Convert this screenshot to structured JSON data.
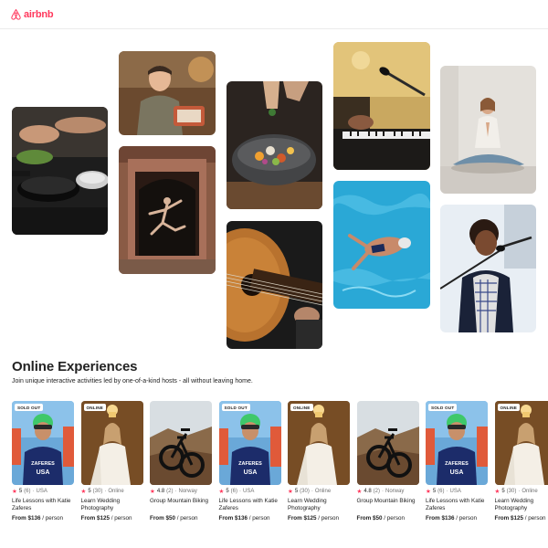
{
  "brand": {
    "name": "airbnb",
    "color": "#ff385c",
    "icon": "airbnb-logo-icon"
  },
  "mosaic": [
    {
      "name": "cooking-pan-photo",
      "subject": "cooking"
    },
    {
      "name": "baker-woman-photo",
      "subject": "baking"
    },
    {
      "name": "dancer-doorway-photo",
      "subject": "dance"
    },
    {
      "name": "food-bowl-photo",
      "subject": "food"
    },
    {
      "name": "guitar-photo",
      "subject": "guitar"
    },
    {
      "name": "keyboard-microphone-photo",
      "subject": "music"
    },
    {
      "name": "swimmer-pool-photo",
      "subject": "swimming"
    },
    {
      "name": "meditation-photo",
      "subject": "yoga"
    },
    {
      "name": "singer-photo",
      "subject": "singing"
    }
  ],
  "section": {
    "title": "Online Experiences",
    "subtitle": "Join unique interactive activities led by one-of-a-kind hosts - all without leaving home."
  },
  "cards": [
    {
      "badge": "SOLD OUT",
      "rating": "5",
      "reviews": "(6)",
      "location": "USA",
      "title": "Life Lessons with Katie Zaferes",
      "price_prefix": "From",
      "price": "$136",
      "price_suffix": "/ person",
      "image": "swimmer"
    },
    {
      "badge": "ONLINE",
      "rating": "5",
      "reviews": "(30)",
      "location": "Online",
      "title": "Learn Wedding Photography",
      "price_prefix": "From",
      "price": "$125",
      "price_suffix": "/ person",
      "image": "bride"
    },
    {
      "badge": "",
      "rating": "4.8",
      "reviews": "(2)",
      "location": "Norway",
      "title": "Group Mountain Biking",
      "price_prefix": "From",
      "price": "$50",
      "price_suffix": "/ person",
      "image": "bike"
    },
    {
      "badge": "SOLD OUT",
      "rating": "5",
      "reviews": "(6)",
      "location": "USA",
      "title": "Life Lessons with Katie Zaferes",
      "price_prefix": "From",
      "price": "$136",
      "price_suffix": "/ person",
      "image": "swimmer"
    },
    {
      "badge": "ONLINE",
      "rating": "5",
      "reviews": "(30)",
      "location": "Online",
      "title": "Learn Wedding Photography",
      "price_prefix": "From",
      "price": "$125",
      "price_suffix": "/ person",
      "image": "bride"
    },
    {
      "badge": "",
      "rating": "4.8",
      "reviews": "(2)",
      "location": "Norway",
      "title": "Group Mountain Biking",
      "price_prefix": "From",
      "price": "$50",
      "price_suffix": "/ person",
      "image": "bike"
    },
    {
      "badge": "SOLD OUT",
      "rating": "5",
      "reviews": "(6)",
      "location": "USA",
      "title": "Life Lessons with Katie Zaferes",
      "price_prefix": "From",
      "price": "$136",
      "price_suffix": "/ person",
      "image": "swimmer"
    },
    {
      "badge": "ONLINE",
      "rating": "5",
      "reviews": "(30)",
      "location": "Online",
      "title": "Learn Wedding Photography",
      "price_prefix": "From",
      "price": "$125",
      "price_suffix": "/ person",
      "image": "bride"
    }
  ],
  "swimmer_cap_text": "ZAFERES",
  "swimmer_suit_text": "USA",
  "star_icon": "star-icon",
  "colors": {
    "text": "#222222",
    "muted": "#717171",
    "accent": "#ff385c"
  }
}
